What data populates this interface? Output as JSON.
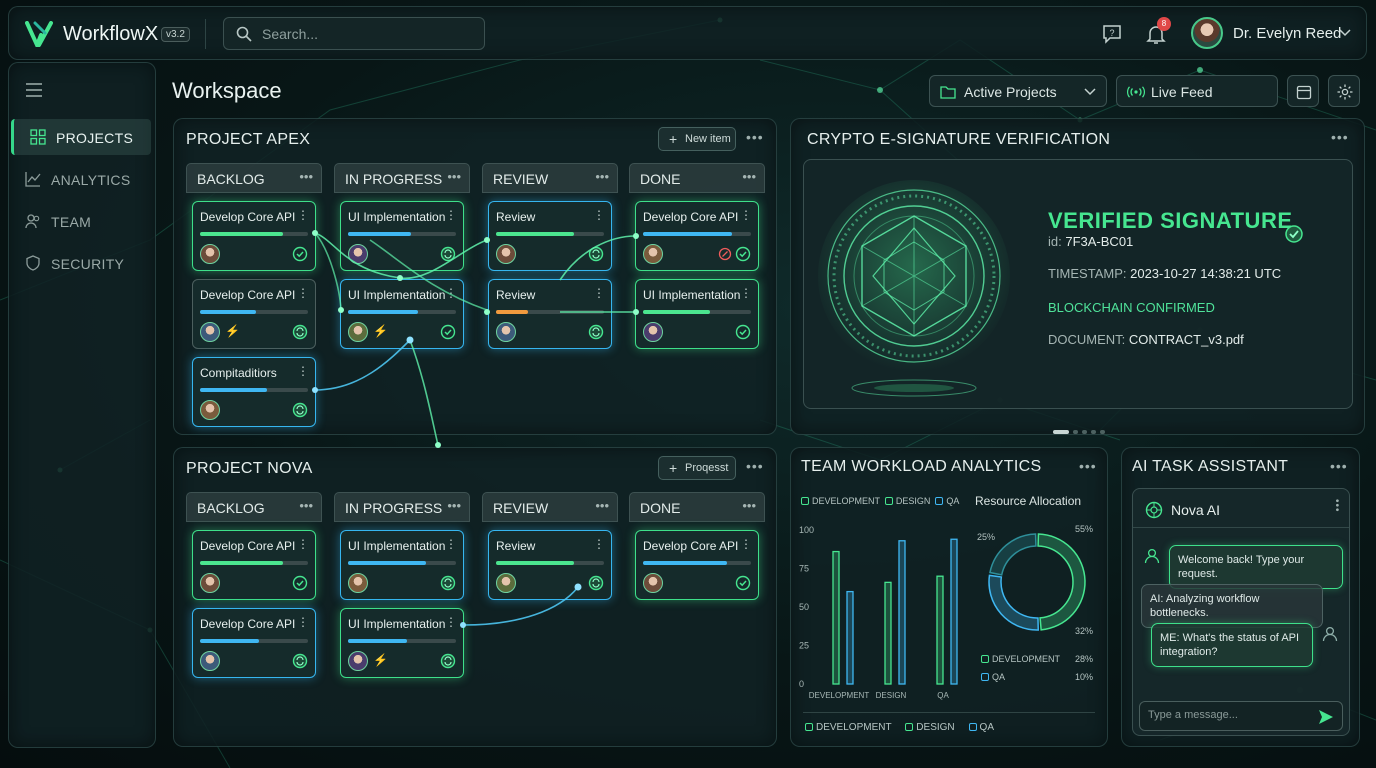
{
  "app": {
    "name": "WorkflowX",
    "version": "v3.2",
    "search_placeholder": "Search...",
    "notifications_count": "8",
    "user_name": "Dr. Evelyn Reed"
  },
  "sidebar": {
    "items": [
      {
        "label": "PROJECTS",
        "icon": "grid-icon",
        "active": true
      },
      {
        "label": "ANALYTICS",
        "icon": "chart-line-icon",
        "active": false
      },
      {
        "label": "TEAM",
        "icon": "team-icon",
        "active": false
      },
      {
        "label": "SECURITY",
        "icon": "shield-icon",
        "active": false
      }
    ]
  },
  "workspace": {
    "title": "Workspace",
    "project_filter": "Active Projects",
    "live_feed": "Live Feed"
  },
  "boards": [
    {
      "title": "PROJECT APEX",
      "action_label": "New item",
      "columns": [
        "BACKLOG",
        "IN PROGRESS",
        "REVIEW",
        "DONE"
      ],
      "cards": [
        {
          "col": 0,
          "row": 0,
          "title": "Develop Core API",
          "style": "green",
          "progress": 0.77,
          "bar": "#4be58f",
          "status": "check"
        },
        {
          "col": 0,
          "row": 1,
          "title": "Develop Core API",
          "style": "grey",
          "progress": 0.52,
          "bar": "#3fb7f2",
          "status": "sync",
          "bolt": true
        },
        {
          "col": 0,
          "row": 2,
          "title": "Compitaditiors",
          "style": "blue",
          "progress": 0.62,
          "bar": "#3fb7f2",
          "status": "sync"
        },
        {
          "col": 1,
          "row": 0,
          "title": "UI Implementation",
          "style": "green",
          "progress": 0.58,
          "bar": "#3fb7f2",
          "status": "sync"
        },
        {
          "col": 1,
          "row": 1,
          "title": "UI Implementation",
          "style": "blue",
          "progress": 0.65,
          "bar": "#3fb7f2",
          "status": "check",
          "bolt": true
        },
        {
          "col": 2,
          "row": 0,
          "title": "Review",
          "style": "blue",
          "progress": 0.72,
          "bar": "#4be58f",
          "status": "sync"
        },
        {
          "col": 2,
          "row": 1,
          "title": "Review",
          "style": "blue",
          "progress": 0.3,
          "bar": "#f19a3e",
          "status": "sync"
        },
        {
          "col": 3,
          "row": 0,
          "title": "Develop Core API",
          "style": "green",
          "progress": 0.82,
          "bar": "#3fb7f2",
          "status": "check",
          "alert": true
        },
        {
          "col": 3,
          "row": 1,
          "title": "UI Implementation",
          "style": "green",
          "progress": 0.62,
          "bar": "#4be58f",
          "status": "check"
        }
      ]
    },
    {
      "title": "PROJECT NOVA",
      "action_label": "Proqesst",
      "columns": [
        "BACKLOG",
        "IN PROGRESS",
        "REVIEW",
        "DONE"
      ],
      "cards": [
        {
          "col": 0,
          "row": 0,
          "title": "Develop Core API",
          "style": "green",
          "progress": 0.77,
          "bar": "#4be58f",
          "status": "check"
        },
        {
          "col": 0,
          "row": 1,
          "title": "Develop Core API",
          "style": "blue",
          "progress": 0.55,
          "bar": "#3fb7f2",
          "status": "sync"
        },
        {
          "col": 1,
          "row": 0,
          "title": "UI Implementation",
          "style": "blue",
          "progress": 0.72,
          "bar": "#3fb7f2",
          "status": "sync"
        },
        {
          "col": 1,
          "row": 1,
          "title": "UI Implementation",
          "style": "green",
          "progress": 0.55,
          "bar": "#3fb7f2",
          "status": "sync",
          "bolt": true
        },
        {
          "col": 2,
          "row": 0,
          "title": "Review",
          "style": "blue",
          "progress": 0.72,
          "bar": "#4be58f",
          "status": "sync"
        },
        {
          "col": 3,
          "row": 0,
          "title": "Develop Core API",
          "style": "green",
          "progress": 0.78,
          "bar": "#3fb7f2",
          "status": "check"
        }
      ]
    }
  ],
  "verification": {
    "title": "CRYPTO E-SIGNATURE VERIFICATION",
    "status": "VERIFIED SIGNATURE",
    "id_label": "id:",
    "id_value": "7F3A-BC01",
    "timestamp_label": "TIMESTAMP:",
    "timestamp_value": "2023-10-27 14:38:21 UTC",
    "chain": "BLOCKCHAIN CONFIRMED",
    "document_label": "DOCUMENT:",
    "document_value": "CONTRACT_v3.pdf"
  },
  "analytics": {
    "title": "TEAM WORKLOAD ANALYTICS",
    "legend": [
      "DEVELOPMENT",
      "DESIGN",
      "QA"
    ],
    "resource_title": "Resource Allocation",
    "donut_labels": {
      "top_left": "25%",
      "top_right": "55%",
      "bottom_right": "32%"
    },
    "donut_legend": [
      {
        "name": "DEVELOPMENT",
        "value": "28%"
      },
      {
        "name": "QA",
        "value": "10%"
      }
    ],
    "bottom_legend": [
      "DEVELOPMENT",
      "DESIGN",
      "QA"
    ]
  },
  "chart_data": [
    {
      "type": "bar",
      "categories": [
        "DEVELOPMENT",
        "DESIGN",
        "QA"
      ],
      "series": [
        {
          "name": "DEVELOPMENT",
          "values": [
            86,
            66,
            70
          ]
        },
        {
          "name": "QA",
          "values": [
            60,
            93,
            94
          ]
        }
      ],
      "ylim": [
        0,
        100
      ],
      "yticks": [
        0,
        25,
        50,
        75,
        100
      ],
      "xlabel": "",
      "ylabel": ""
    },
    {
      "type": "pie",
      "categories": [
        "DEVELOPMENT",
        "DESIGN",
        "QA"
      ],
      "values": [
        55,
        32,
        25
      ]
    }
  ],
  "assistant": {
    "title": "AI TASK ASSISTANT",
    "bot_name": "Nova AI",
    "messages": [
      {
        "from": "user",
        "text": "Welcome back! Type your request."
      },
      {
        "from": "ai",
        "text": "AI: Analyzing workflow bottlenecks."
      },
      {
        "from": "user",
        "text": "ME: What's the status of API integration?"
      }
    ],
    "input_placeholder": "Type a message..."
  },
  "colors": {
    "accent_green": "#3ee08a",
    "accent_blue": "#36b6f0",
    "background": "#081616"
  }
}
